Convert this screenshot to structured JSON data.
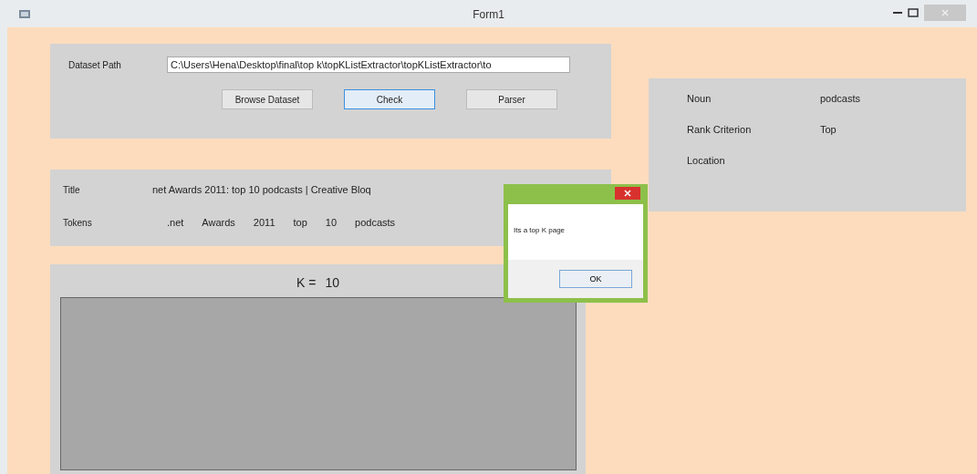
{
  "window": {
    "title": "Form1"
  },
  "dataset": {
    "label": "Dataset Path",
    "value": "C:\\Users\\Hena\\Desktop\\final\\top k\\topKListExtractor\\topKListExtractor\\to",
    "buttons": [
      {
        "label": "Browse Dataset",
        "focused": false
      },
      {
        "label": "Check",
        "focused": true
      },
      {
        "label": "Parser",
        "focused": false
      }
    ]
  },
  "page": {
    "title_label": "Title",
    "title": "net Awards 2011: top 10 podcasts | Creative Bloq",
    "tokens_label": "Tokens",
    "tokens": [
      ".net",
      "Awards",
      "2011",
      "top",
      "10",
      "podcasts"
    ]
  },
  "k": {
    "label": "K =",
    "value": "10"
  },
  "info": [
    {
      "label": "Noun",
      "value": "podcasts"
    },
    {
      "label": "Rank Criterion",
      "value": "Top"
    },
    {
      "label": "Location"
    }
  ],
  "dialog": {
    "message": "Its a top K page",
    "button": "OK"
  }
}
